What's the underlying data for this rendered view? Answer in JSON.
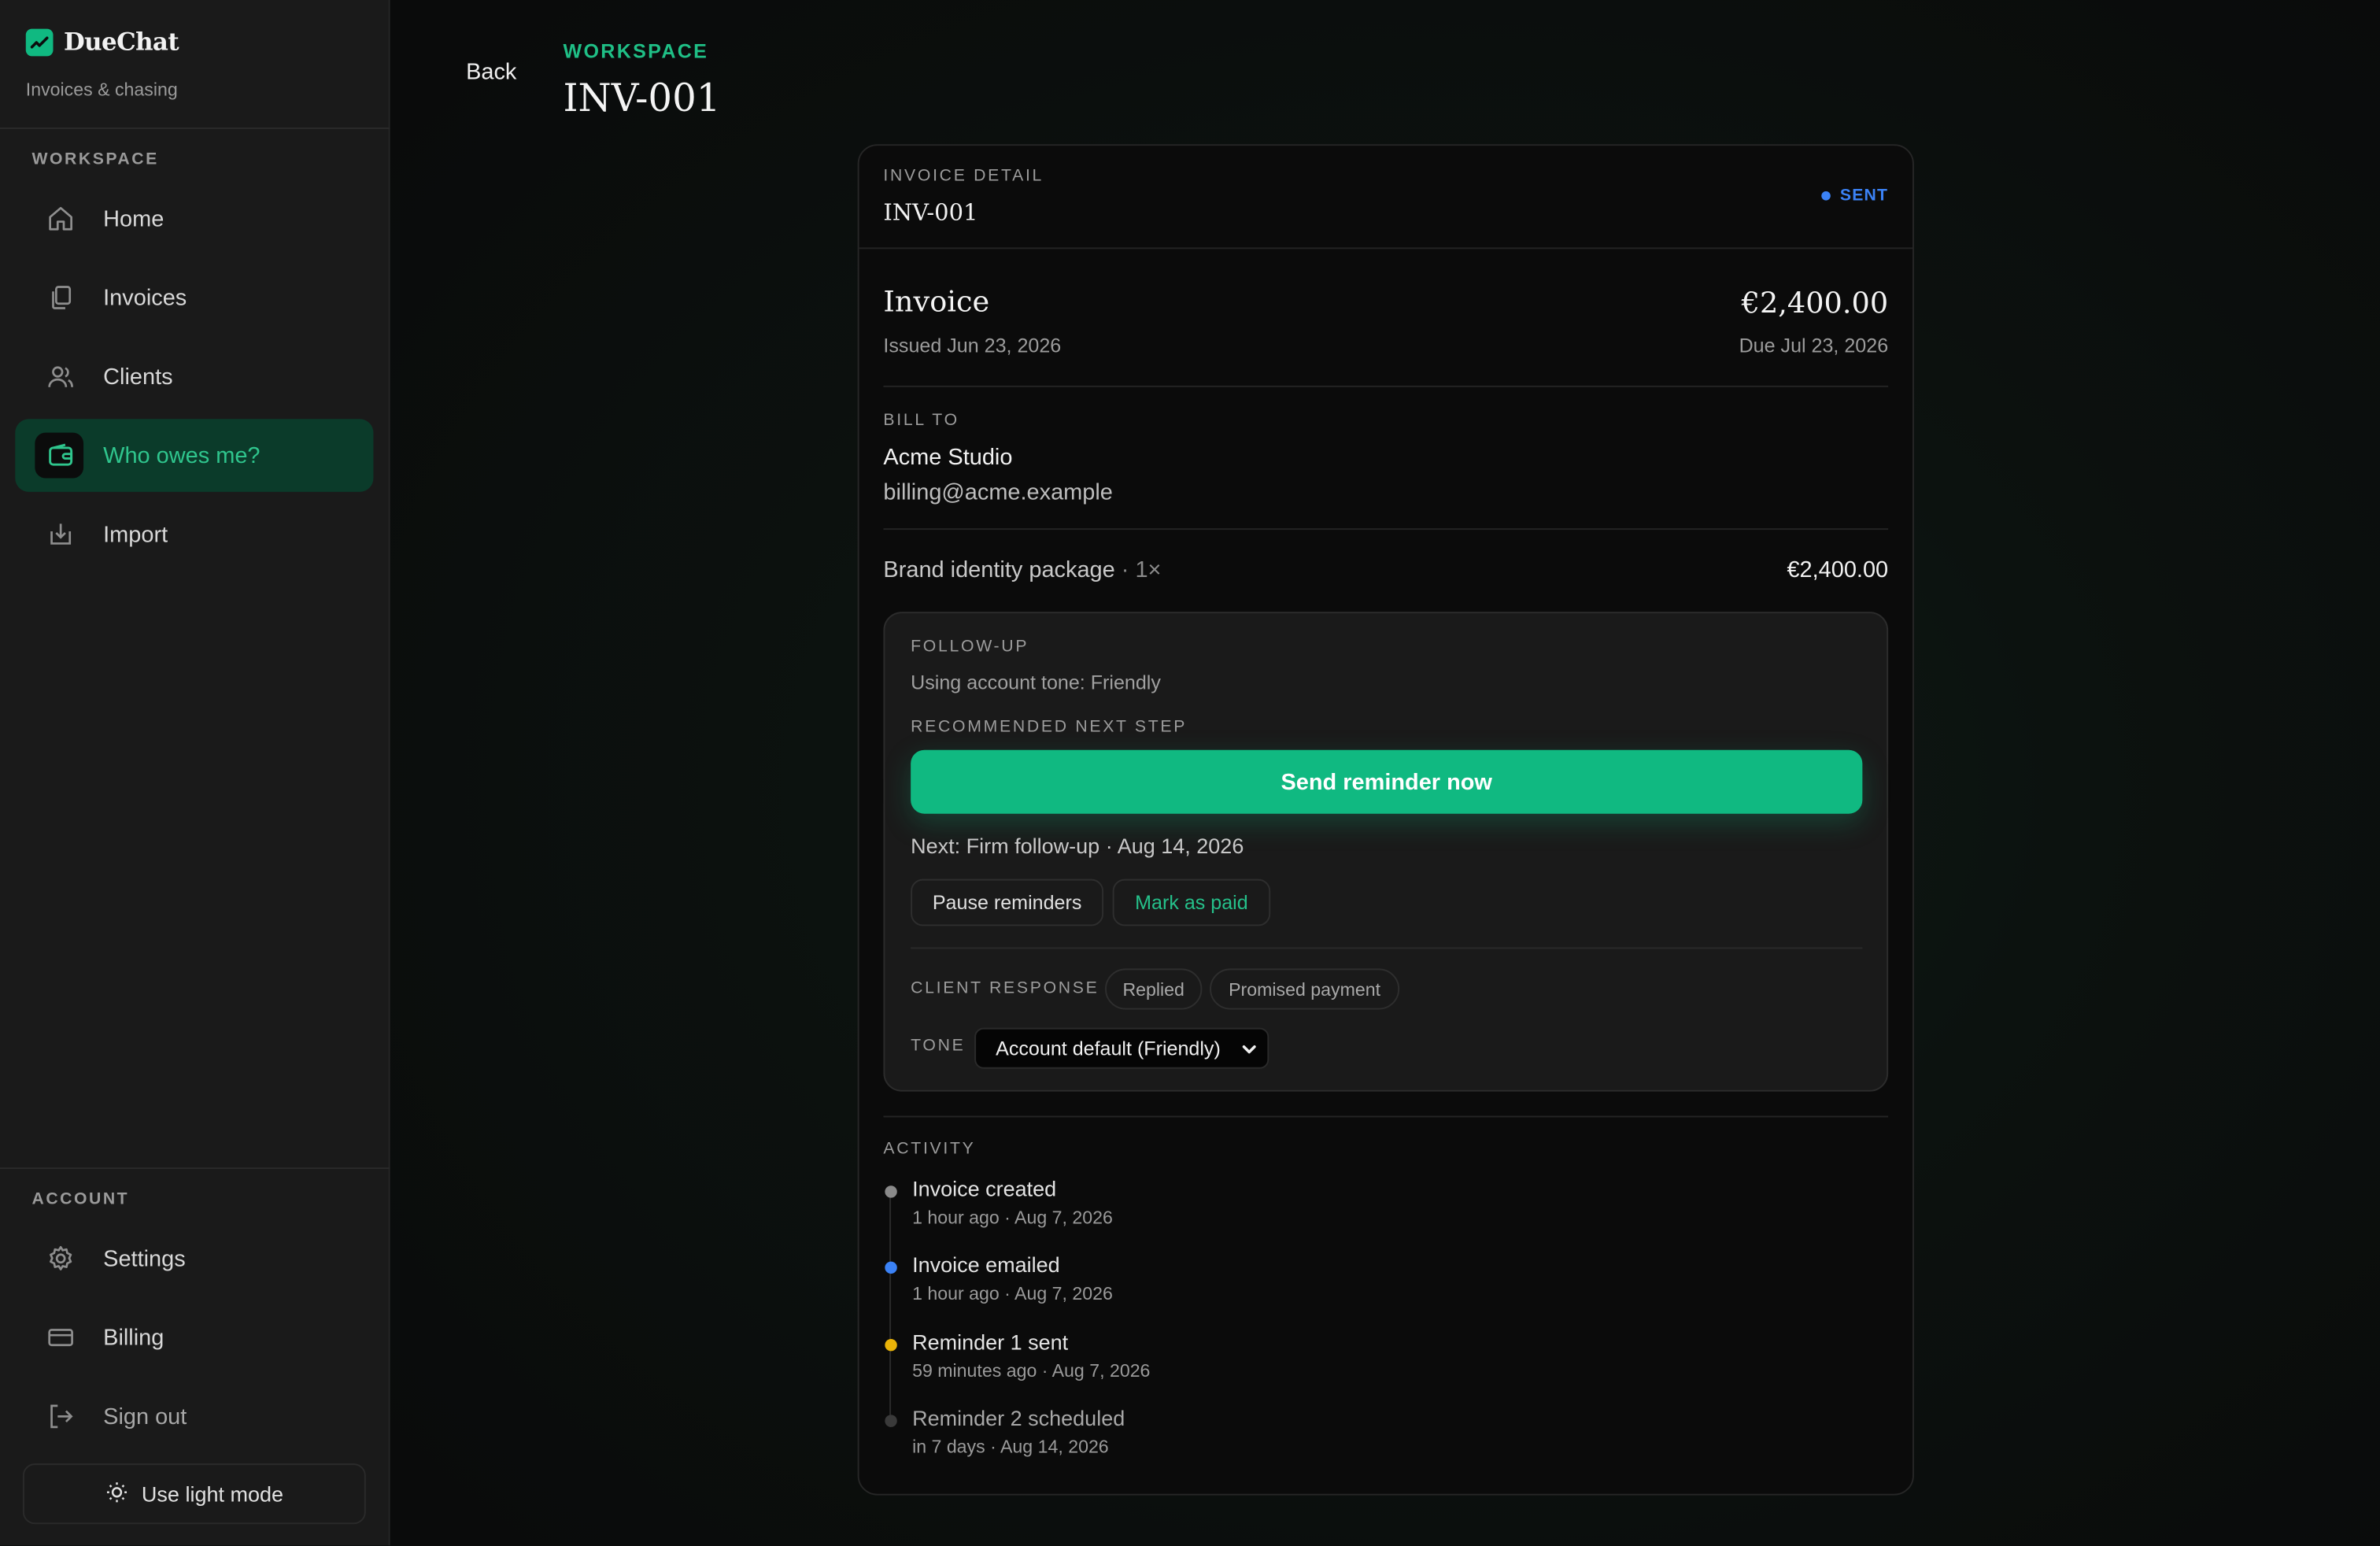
{
  "brand": {
    "name": "DueChat",
    "subtitle": "Invoices & chasing",
    "accent": "#10b981"
  },
  "sidebar": {
    "workspace_label": "WORKSPACE",
    "items": [
      {
        "label": "Home",
        "icon": "home-icon"
      },
      {
        "label": "Invoices",
        "icon": "documents-icon"
      },
      {
        "label": "Clients",
        "icon": "users-icon"
      },
      {
        "label": "Who owes me?",
        "icon": "wallet-icon",
        "active": true
      },
      {
        "label": "Import",
        "icon": "import-icon"
      }
    ],
    "account_label": "ACCOUNT",
    "account_items": [
      {
        "label": "Settings",
        "icon": "gear-icon"
      },
      {
        "label": "Billing",
        "icon": "credit-card-icon"
      },
      {
        "label": "Sign out",
        "icon": "sign-out-icon"
      }
    ],
    "theme_toggle": "Use light mode"
  },
  "header": {
    "back": "Back",
    "eyebrow": "WORKSPACE",
    "title": "INV-001"
  },
  "card": {
    "label": "INVOICE DETAIL",
    "number": "INV-001",
    "status": "SENT",
    "status_color": "#3b82f6",
    "heading": "Invoice",
    "amount": "€2,400.00",
    "issued": "Issued Jun 23, 2026",
    "due": "Due Jul 23, 2026",
    "bill_to_label": "BILL TO",
    "client_name": "Acme Studio",
    "client_email": "billing@acme.example",
    "line_item": "Brand identity package",
    "line_qty": "· 1×",
    "line_amount": "€2,400.00"
  },
  "followup": {
    "label": "FOLLOW-UP",
    "tone_note": "Using account tone: Friendly",
    "recommended_label": "RECOMMENDED NEXT STEP",
    "primary_action": "Send reminder now",
    "next": "Next: Firm follow-up · Aug 14, 2026",
    "pause": "Pause reminders",
    "mark_paid": "Mark as paid",
    "client_response_label": "CLIENT RESPONSE",
    "responses": [
      "Replied",
      "Promised payment"
    ],
    "tone_label": "TONE",
    "tone_value": "Account default (Friendly)"
  },
  "activity": {
    "label": "ACTIVITY",
    "items": [
      {
        "title": "Invoice created",
        "meta": "1 hour ago · Aug 7, 2026",
        "color": "#8a8a8a"
      },
      {
        "title": "Invoice emailed",
        "meta": "1 hour ago · Aug 7, 2026",
        "color": "#3b82f6"
      },
      {
        "title": "Reminder 1 sent",
        "meta": "59 minutes ago · Aug 7, 2026",
        "color": "#eab308"
      },
      {
        "title": "Reminder 2 scheduled",
        "meta": "in 7 days · Aug 14, 2026",
        "color": "#3a3a3a"
      }
    ]
  }
}
